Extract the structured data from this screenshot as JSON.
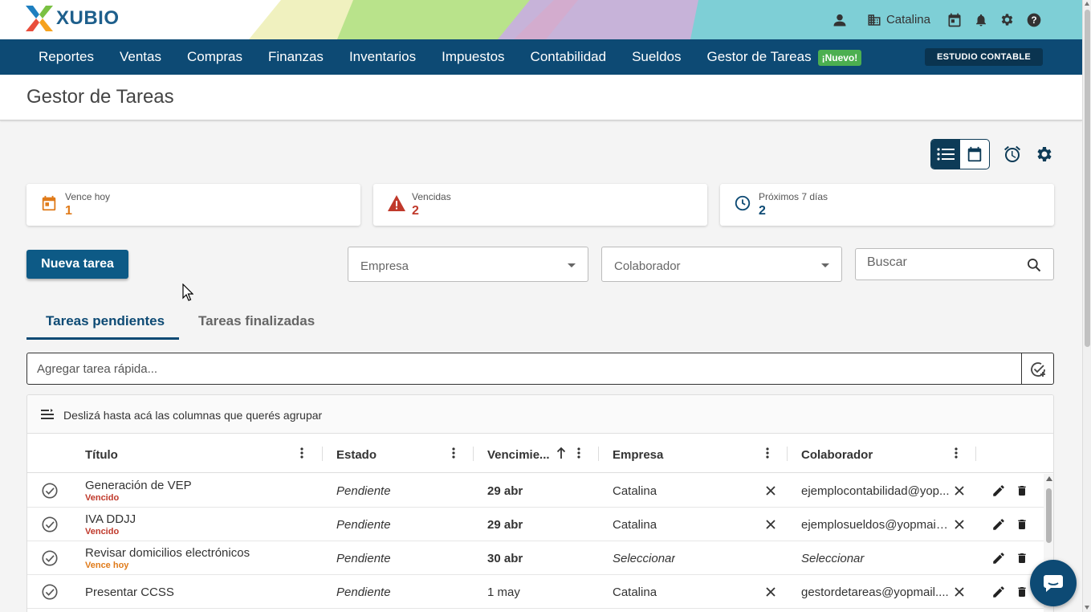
{
  "header": {
    "logo_text": "XUBIO",
    "company_name": "Catalina",
    "icons": [
      "user-icon",
      "building-icon",
      "calendar-icon",
      "bell-icon",
      "gear-icon",
      "help-icon"
    ]
  },
  "nav": {
    "items": [
      "Reportes",
      "Ventas",
      "Compras",
      "Finanzas",
      "Inventarios",
      "Impuestos",
      "Contabilidad",
      "Sueldos"
    ],
    "task_manager": "Gestor de Tareas",
    "new_badge": "¡Nuevo!",
    "studio_button": "ESTUDIO CONTABLE"
  },
  "page": {
    "title": "Gestor de Tareas"
  },
  "summary": {
    "due_today_label": "Vence hoy",
    "due_today_value": "1",
    "overdue_label": "Vencidas",
    "overdue_value": "2",
    "next7_label": "Próximos 7 días",
    "next7_value": "2"
  },
  "actions": {
    "new_task": "Nueva tarea",
    "company_placeholder": "Empresa",
    "collaborator_placeholder": "Colaborador",
    "search_placeholder": "Buscar"
  },
  "tabs": {
    "pending": "Tareas pendientes",
    "finished": "Tareas finalizadas"
  },
  "quick_add": {
    "placeholder": "Agregar tarea rápida..."
  },
  "grid": {
    "group_hint": "Deslizá hasta acá las columnas que querés agrupar",
    "columns": {
      "title": "Título",
      "status": "Estado",
      "due": "Vencimie...",
      "company": "Empresa",
      "collaborator": "Colaborador"
    },
    "rows": [
      {
        "title": "Generación de VEP",
        "sub": "Vencido",
        "status": "Pendiente",
        "due": "29 abr",
        "company": "Catalina",
        "collaborator": "ejemplocontabilidad@yop..."
      },
      {
        "title": "IVA DDJJ",
        "sub": "Vencido",
        "status": "Pendiente",
        "due": "29 abr",
        "company": "Catalina",
        "collaborator": "ejemplosueldos@yopmail...."
      },
      {
        "title": "Revisar domicilios electrónicos",
        "sub": "Vence hoy",
        "status": "Pendiente",
        "due": "30 abr",
        "company": "Seleccionar",
        "collaborator": "Seleccionar"
      },
      {
        "title": "Presentar CCSS",
        "sub": "",
        "status": "Pendiente",
        "due": "1 may",
        "company": "Catalina",
        "collaborator": "gestordetareas@yopmail...."
      }
    ]
  },
  "colors": {
    "brand": "#0d4a74",
    "overdue": "#c0392b",
    "due_today": "#e07b1a",
    "new_badge": "#4caf50"
  }
}
